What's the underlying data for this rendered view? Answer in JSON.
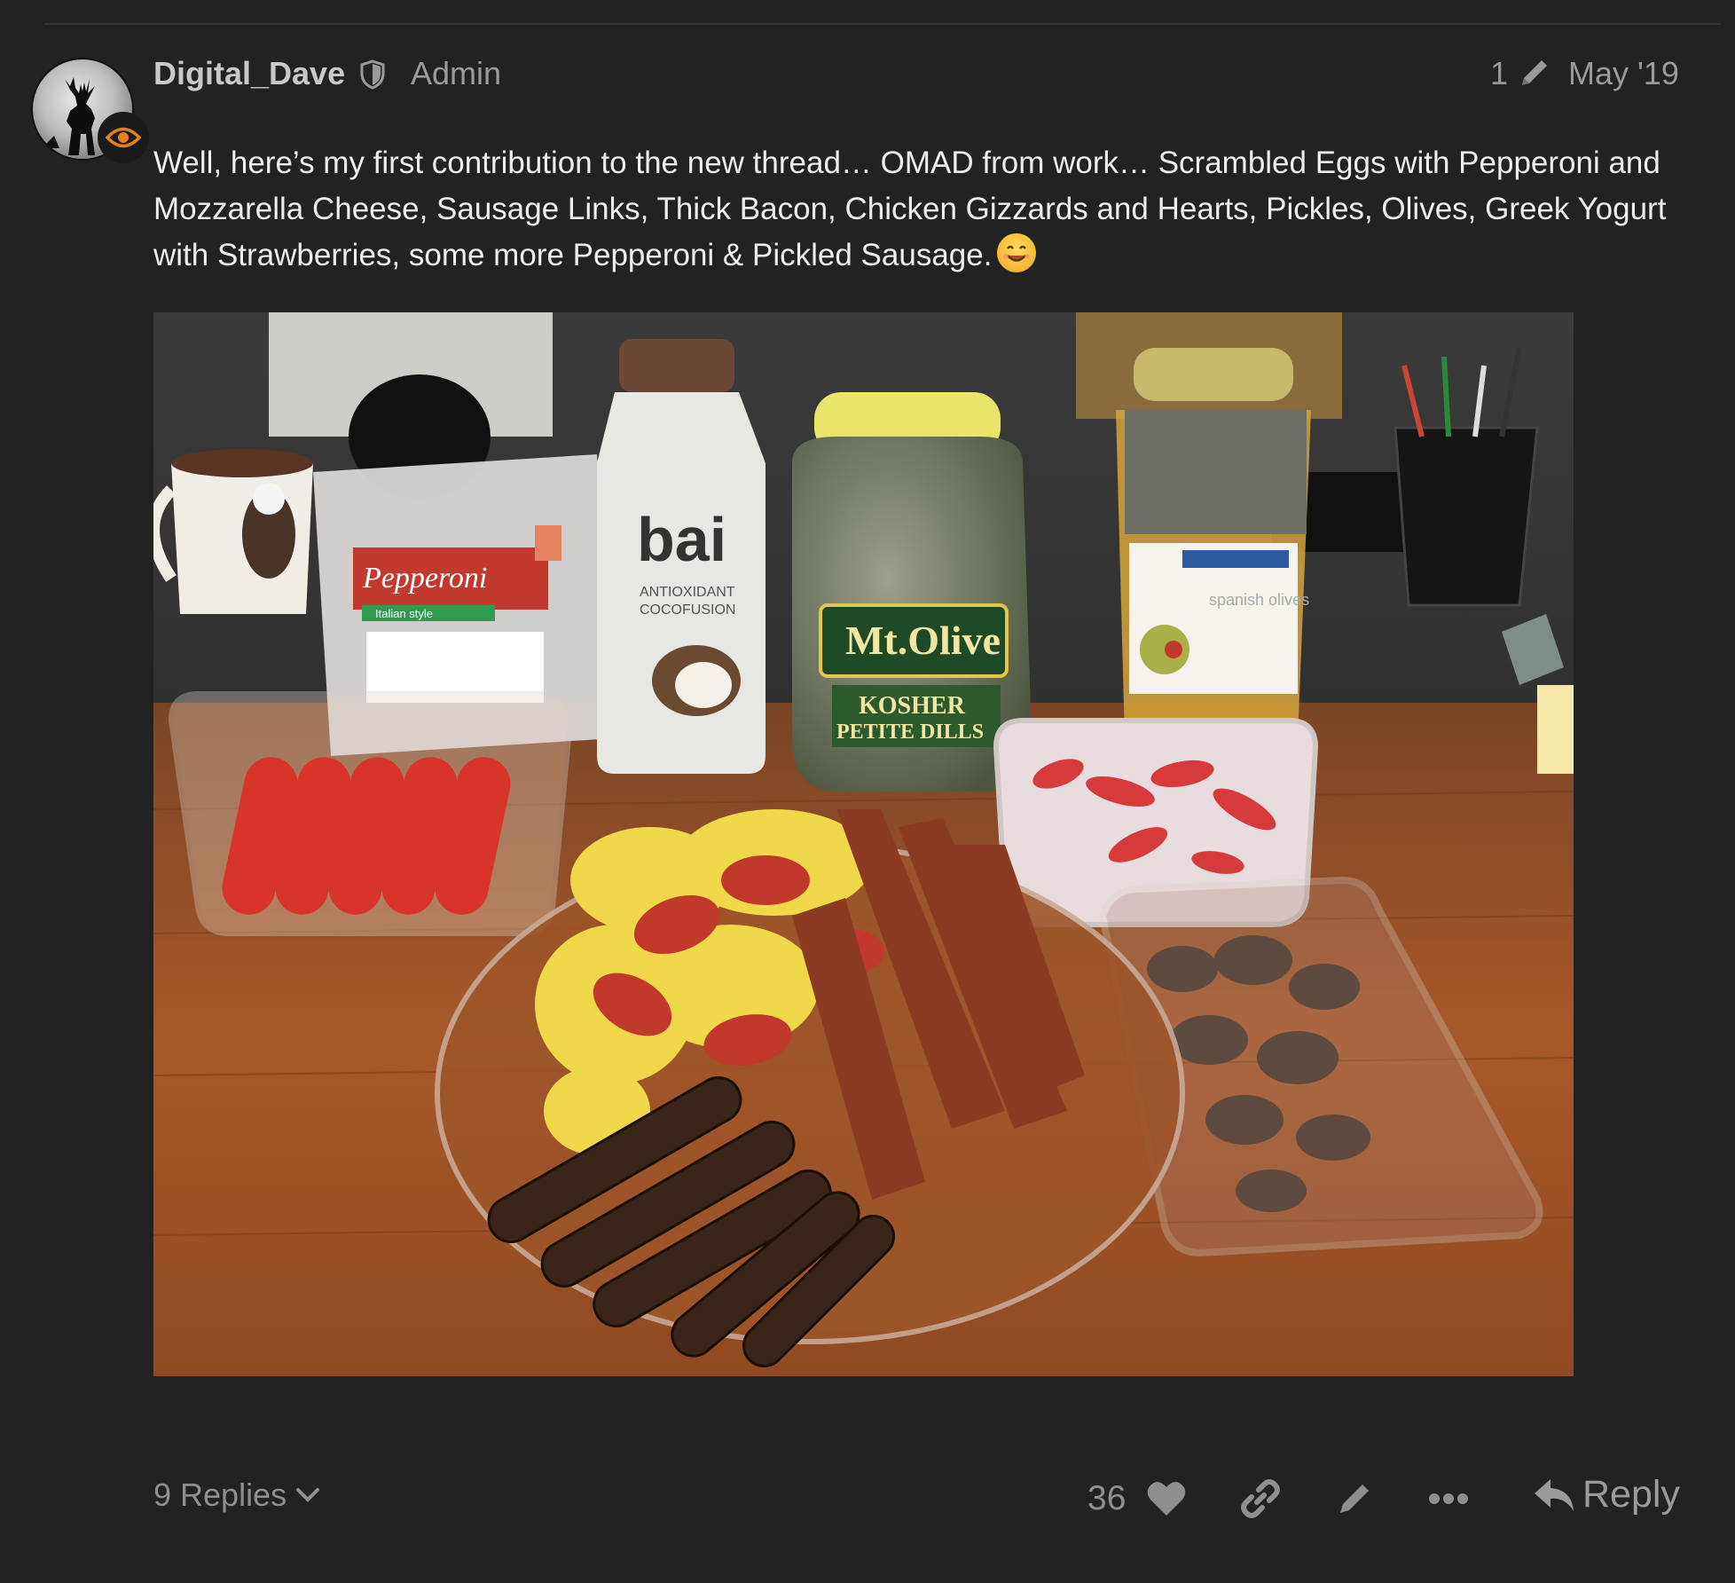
{
  "post": {
    "username": "Digital_Dave",
    "role": "Admin",
    "edit_count": "1",
    "date": "May '19",
    "body": "Well, here’s my first contribution to the new thread… OMAD from work… Scrambled Eggs with Pepperoni and Mozzarella Cheese, Sausage Links, Thick Bacon, Chicken Gizzards and Hearts, Pickles, Olives, Greek Yogurt with Strawberries, some more Pepperoni & Pickled Sausage."
  },
  "photo": {
    "labels": {
      "pepperoni": "Pepperoni",
      "pepperoni_sub": "Italian style",
      "bai": "bai",
      "bai_sub1": "ANTIOXIDANT",
      "bai_sub2": "COCOFUSION",
      "mtolive": "Mt.Olive",
      "kosher": "KOSHER",
      "petite": "PETITE DILLS",
      "olives": "spanish olives"
    }
  },
  "footer": {
    "replies_label": "9 Replies",
    "like_count": "36",
    "reply_label": "Reply"
  },
  "colors": {
    "background": "#222222",
    "text": "#eeeeee",
    "muted": "#9a9a9a",
    "flair_accent": "#e8801a"
  }
}
